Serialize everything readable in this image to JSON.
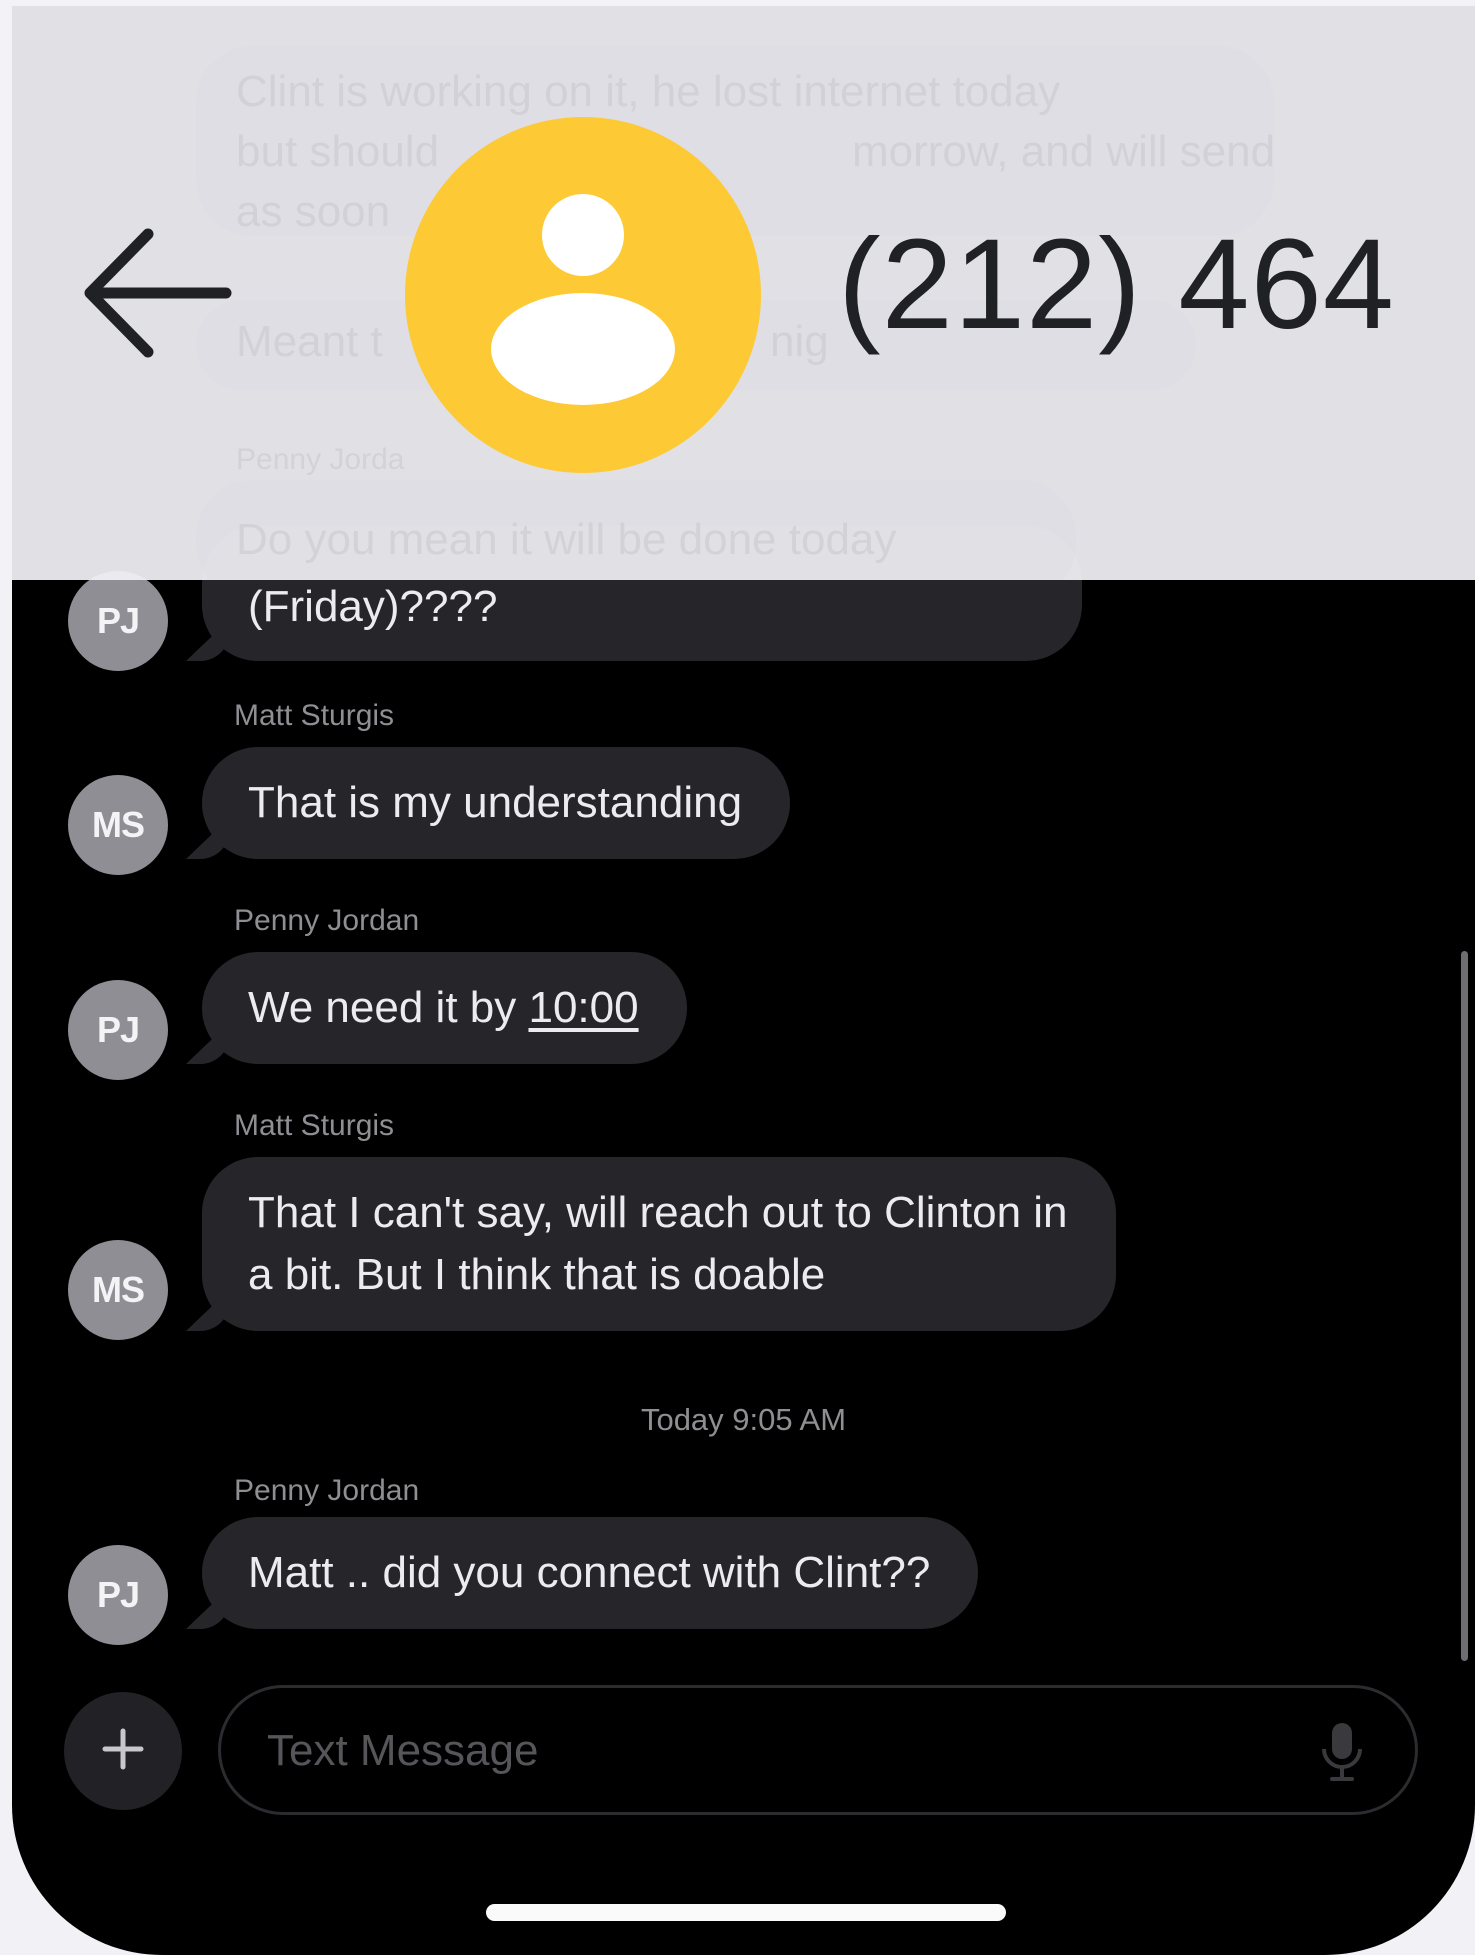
{
  "header": {
    "contact_name": "(212) 464",
    "ghost_lines": [
      "Clint is working on it, he lost internet today",
      "but should",
      "morrow, and will send",
      "as soon",
      "Meant t",
      "nig",
      "Penny Jorda",
      "Do you mean it will be done today"
    ]
  },
  "messages": [
    {
      "sender": "",
      "initials": "PJ",
      "text": "(Friday)????"
    },
    {
      "sender": "Matt Sturgis",
      "initials": "MS",
      "text": "That is my understanding"
    },
    {
      "sender": "Penny Jordan",
      "initials": "PJ",
      "text_prefix": "We need it by ",
      "text_link": "10:00"
    },
    {
      "sender": "Matt Sturgis",
      "initials": "MS",
      "text_lines": [
        "That I can't say, will reach out to Clinton in",
        "a bit. But I think that is doable"
      ]
    },
    {
      "sender": "Penny Jordan",
      "initials": "PJ",
      "text": "Matt ..  did you connect with Clint??"
    }
  ],
  "timestamp": "Today 9:05 AM",
  "composer": {
    "placeholder": "Text Message"
  },
  "colors": {
    "contact_avatar": "#fdc934",
    "thread_background": "#000000",
    "bubble": "#26262a",
    "avatar": "#8e8e94"
  },
  "icons": {
    "back": "arrow-left",
    "add": "plus",
    "mic": "microphone",
    "contact": "person"
  }
}
